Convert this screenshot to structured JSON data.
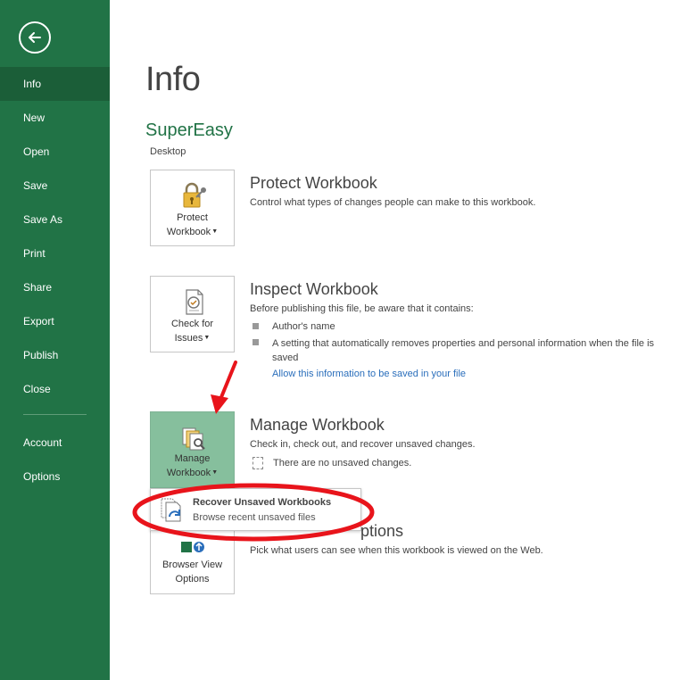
{
  "sidebar": {
    "back_icon": "back-arrow-icon",
    "items": [
      {
        "label": "Info",
        "active": true
      },
      {
        "label": "New"
      },
      {
        "label": "Open"
      },
      {
        "label": "Save"
      },
      {
        "label": "Save As"
      },
      {
        "label": "Print"
      },
      {
        "label": "Share"
      },
      {
        "label": "Export"
      },
      {
        "label": "Publish"
      },
      {
        "label": "Close"
      }
    ],
    "bottom_items": [
      {
        "label": "Account"
      },
      {
        "label": "Options"
      }
    ]
  },
  "page": {
    "title": "Info",
    "file_name": "SuperEasy",
    "file_location": "Desktop"
  },
  "protect": {
    "button_line1": "Protect",
    "button_line2": "Workbook",
    "title": "Protect Workbook",
    "description": "Control what types of changes people can make to this workbook."
  },
  "inspect": {
    "button_line1": "Check for",
    "button_line2": "Issues",
    "title": "Inspect Workbook",
    "description": "Before publishing this file, be aware that it contains:",
    "bullets": [
      "Author's name",
      "A setting that automatically removes properties and personal information when the file is saved"
    ],
    "link": "Allow this information to be saved in your file"
  },
  "manage": {
    "button_line1": "Manage",
    "button_line2": "Workbook",
    "title": "Manage Workbook",
    "description": "Check in, check out, and recover unsaved changes.",
    "status": "There are no unsaved changes."
  },
  "browser": {
    "button_line1": "Browser View",
    "button_line2": "Options",
    "title_visible": "ptions",
    "description": "Pick what users can see when this workbook is viewed on the Web."
  },
  "dropdown": {
    "title": "Recover Unsaved Workbooks",
    "subtitle": "Browse recent unsaved files"
  },
  "colors": {
    "sidebar": "#217346",
    "sidebar_active": "#1b5e38",
    "selected_tile": "#86bf9d",
    "link": "#2a6ebb",
    "annotation": "#e8141b"
  }
}
